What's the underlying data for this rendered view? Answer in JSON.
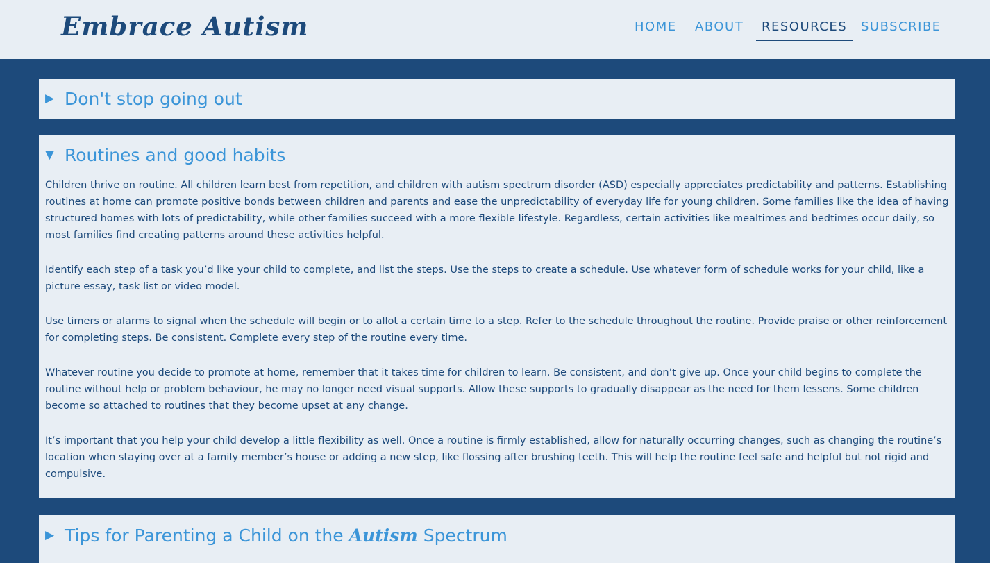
{
  "site": {
    "logo": "Embrace Autism"
  },
  "nav": {
    "items": [
      {
        "label": "HOME"
      },
      {
        "label": "ABOUT"
      },
      {
        "label": "RESOURCES"
      },
      {
        "label": "SUBSCRIBE"
      }
    ],
    "active": "RESOURCES"
  },
  "icons": {
    "collapsed": "caret-right-icon",
    "expanded": "caret-down-icon"
  },
  "colors": {
    "brand_dark": "#1d4a7b",
    "accent": "#3b95d8",
    "panel_bg": "#e8eef4"
  },
  "panels": [
    {
      "title": "Don't stop going out",
      "expanded": false
    },
    {
      "title": "Routines and good habits",
      "expanded": true,
      "paragraphs": [
        "Children thrive on routine. All children learn best from repetition, and children with autism spectrum disorder (ASD) especially appreciates predictability and patterns. Establishing routines at home can promote positive bonds between children and parents and ease the unpredictability of everyday life for young children. Some families like the idea of having structured homes with lots of predictability, while other families succeed with a more flexible lifestyle. Regardless, certain activities like mealtimes and bedtimes occur daily, so most families find creating patterns around these activities helpful.",
        "Identify each step of a task you’d like your child to complete, and list the steps. Use the steps to create a schedule. Use whatever form of schedule works for your child, like a picture essay, task list or video model.",
        "Use timers or alarms to signal when the schedule will begin or to allot a certain time to a step. Refer to the schedule throughout the routine. Provide praise or other reinforcement for completing steps. Be consistent. Complete every step of the routine every time.",
        "Whatever routine you decide to promote at home, remember that it takes time for children to learn. Be consistent, and don’t give up. Once your child begins to complete the routine without help or problem behaviour, he may no longer need visual supports. Allow these supports to gradually disappear as the need for them lessens. Some children become so attached to routines that they become upset at any change.",
        "It’s important that you help your child develop a little flexibility as well. Once a routine is firmly established, allow for naturally occurring changes, such as changing the routine’s location when staying over at a family member’s house or adding a new step, like flossing after brushing teeth. This will help the routine feel safe and helpful but not rigid and compulsive."
      ]
    },
    {
      "title_parts": [
        "Tips for Parenting a Child on the ",
        "Autism",
        " Spectrum"
      ],
      "expanded": false
    }
  ]
}
